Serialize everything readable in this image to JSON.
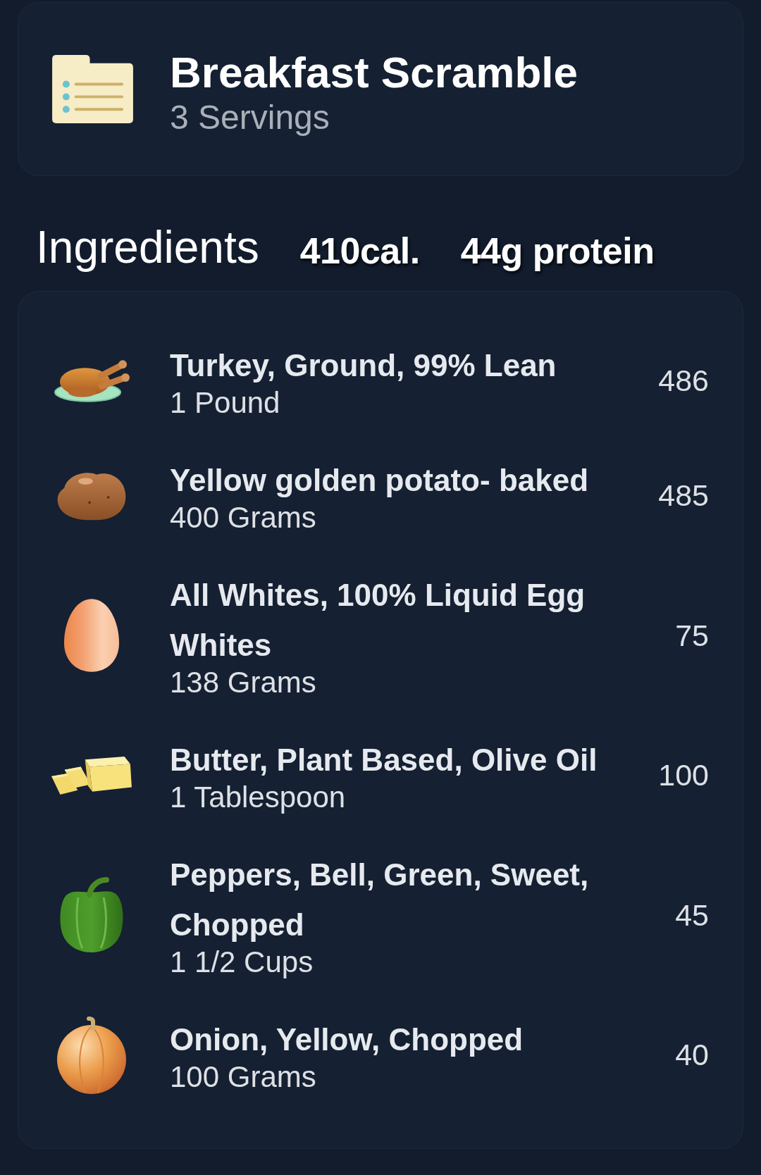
{
  "recipe": {
    "title": "Breakfast Scramble",
    "servings": "3 Servings"
  },
  "ingredients_header": {
    "title": "Ingredients",
    "calories": "410cal.",
    "protein": "44g protein"
  },
  "ingredients": [
    {
      "kind": "poultry",
      "name": "Turkey, Ground, 99% Lean",
      "quantity": "1 Pound",
      "calories": "486"
    },
    {
      "kind": "potato",
      "name": "Yellow golden potato- baked",
      "quantity": "400 Grams",
      "calories": "485"
    },
    {
      "kind": "egg",
      "name": "All Whites, 100% Liquid Egg Whites",
      "quantity": "138 Grams",
      "calories": "75"
    },
    {
      "kind": "butter",
      "name": "Butter, Plant Based, Olive Oil",
      "quantity": "1 Tablespoon",
      "calories": "100"
    },
    {
      "kind": "pepper",
      "name": "Peppers, Bell, Green, Sweet, Chopped",
      "quantity": "1 1/2 Cups",
      "calories": "45"
    },
    {
      "kind": "onion",
      "name": "Onion, Yellow, Chopped",
      "quantity": "100 Grams",
      "calories": "40"
    }
  ]
}
